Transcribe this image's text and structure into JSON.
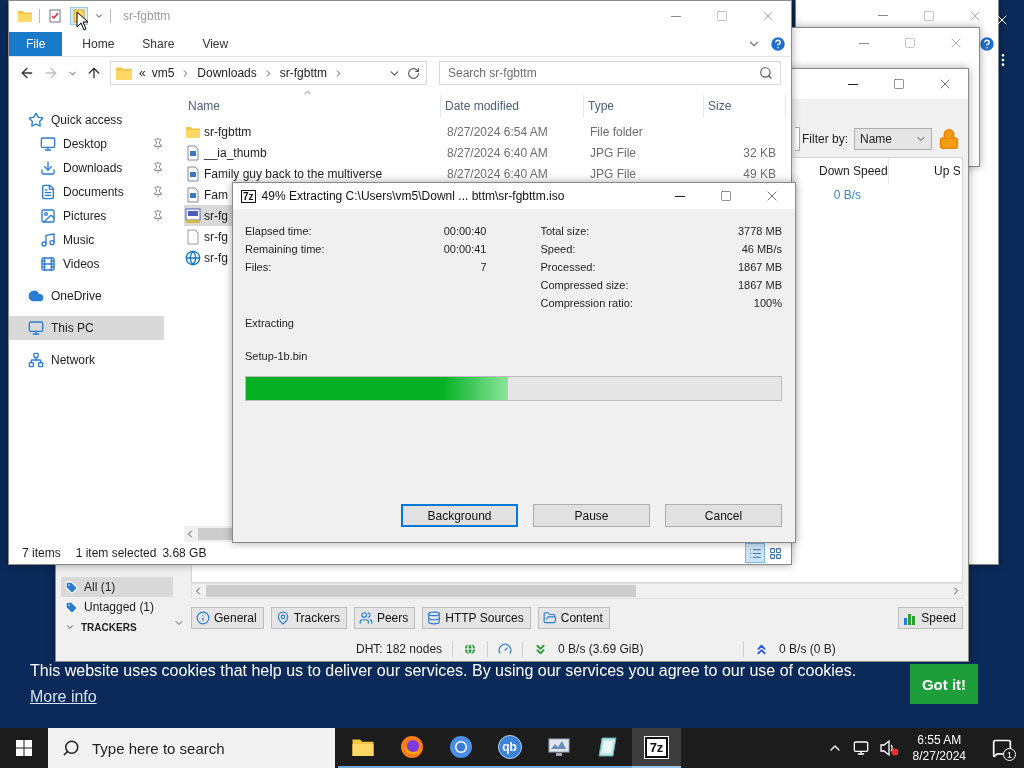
{
  "explorer": {
    "title": "sr-fgbttm",
    "ribbon_tabs": [
      {
        "label": "File",
        "kind": "file"
      },
      {
        "label": "Home",
        "kind": "tab"
      },
      {
        "label": "Share",
        "kind": "tab"
      },
      {
        "label": "View",
        "kind": "tab"
      }
    ],
    "address": {
      "overflow": "«",
      "path": [
        "vm5",
        "Downloads",
        "sr-fgbttm"
      ]
    },
    "search": {
      "placeholder": "Search sr-fgbttm"
    },
    "nav": [
      {
        "label": "Quick access",
        "kind": "star",
        "selected": false,
        "children": [
          {
            "label": "Desktop",
            "kind": "desktop",
            "pinned": true,
            "selected": false
          },
          {
            "label": "Downloads",
            "kind": "downloads",
            "pinned": true,
            "selected": false
          },
          {
            "label": "Documents",
            "kind": "documents",
            "pinned": true,
            "selected": false
          },
          {
            "label": "Pictures",
            "kind": "pictures",
            "pinned": true,
            "selected": false
          },
          {
            "label": "Music",
            "kind": "music",
            "pinned": false,
            "selected": false
          },
          {
            "label": "Videos",
            "kind": "videos",
            "pinned": false,
            "selected": false
          }
        ]
      },
      {
        "label": "OneDrive",
        "kind": "cloud",
        "selected": false
      },
      {
        "label": "This PC",
        "kind": "pc",
        "selected": true
      },
      {
        "label": "Network",
        "kind": "network",
        "selected": false
      }
    ],
    "columns": [
      "Name",
      "Date modified",
      "Type",
      "Size"
    ],
    "files": [
      {
        "name": "sr-fgbttm",
        "kind": "folder",
        "date": "8/27/2024 6:54 AM",
        "type": "File folder",
        "selected": false
      },
      {
        "name": "__ia_thumb",
        "kind": "image",
        "date": "8/27/2024 6:40 AM",
        "type": "JPG File",
        "size": "32 KB",
        "selected": false
      },
      {
        "name": "Family guy back to the multiverse",
        "kind": "image",
        "date": "8/27/2024 6:40 AM",
        "type": "JPG File",
        "size": "49 KB",
        "selected": false
      },
      {
        "name": "Fam",
        "kind": "image",
        "selected": false
      },
      {
        "name": "sr-fg",
        "kind": "disc",
        "selected": true
      },
      {
        "name": "sr-fg",
        "kind": "blank",
        "selected": false
      },
      {
        "name": "sr-fg",
        "kind": "edge",
        "selected": false
      }
    ],
    "status": {
      "count": "7 items",
      "selection": "1 item selected",
      "size": "3.68 GB"
    },
    "views": [
      {
        "kind": "details",
        "selected": true
      },
      {
        "kind": "tiles",
        "selected": false
      }
    ]
  },
  "extract_dialog": {
    "badge": "7z",
    "title": "49% Extracting C:\\Users\\vm5\\Downl ... bttm\\sr-fgbttm.iso",
    "stats_left": [
      {
        "label": "Elapsed time:",
        "value": "00:00:40"
      },
      {
        "label": "Remaining time:",
        "value": "00:00:41"
      },
      {
        "label": "Files:",
        "value": "7"
      }
    ],
    "stats_right": [
      {
        "label": "Total size:",
        "value": "3778 MB"
      },
      {
        "label": "Speed:",
        "value": "46 MB/s"
      },
      {
        "label": "Processed:",
        "value": "1867 MB"
      },
      {
        "label": "Compressed size:",
        "value": "1867 MB"
      },
      {
        "label": "Compression ratio:",
        "value": "100%"
      }
    ],
    "state": "Extracting",
    "file": "Setup-1b.bin",
    "progress": {
      "level": 0.49
    },
    "buttons": [
      {
        "label": "Background",
        "focused": true
      },
      {
        "label": "Pause",
        "focused": false
      },
      {
        "label": "Cancel",
        "focused": false
      }
    ]
  },
  "torrent_client": {
    "filter_label": "Filter by:",
    "filter_value": "Name",
    "columns": [
      "Down Speed",
      "Up S"
    ],
    "rows": [
      {
        "down_speed": "0 B/s"
      }
    ],
    "categories": [
      {
        "label": "All (1)",
        "selected": true
      },
      {
        "label": "Untagged (1)",
        "selected": false
      }
    ],
    "section": "TRACKERS",
    "tabs": [
      {
        "label": "General",
        "kind": "info"
      },
      {
        "label": "Trackers",
        "kind": "pin"
      },
      {
        "label": "Peers",
        "kind": "people"
      },
      {
        "label": "HTTP Sources",
        "kind": "database"
      },
      {
        "label": "Content",
        "kind": "folder"
      }
    ],
    "speed_tab": "Speed",
    "status": {
      "dht": "DHT: 182 nodes",
      "down": "0 B/s (3.69 GiB)",
      "up": "0 B/s (0 B)"
    }
  },
  "cookie_banner": {
    "text": "This website uses cookies that help us to deliver our services. By using our services you agree to our use of cookies.",
    "link": "More info",
    "button": "Got it!"
  },
  "taskbar": {
    "search_placeholder": "Type here to search",
    "apps": [
      {
        "kind": "folder",
        "selected": false
      },
      {
        "kind": "flame",
        "selected": false
      },
      {
        "kind": "ring",
        "selected": false
      },
      {
        "kind": "badge",
        "label": "qb",
        "selected": false
      },
      {
        "kind": "screen",
        "selected": false
      },
      {
        "kind": "slate",
        "selected": false
      },
      {
        "kind": "square",
        "label": "7z",
        "selected": true
      }
    ],
    "time": "6:55 AM",
    "date": "8/27/2024",
    "notifications": "1"
  }
}
